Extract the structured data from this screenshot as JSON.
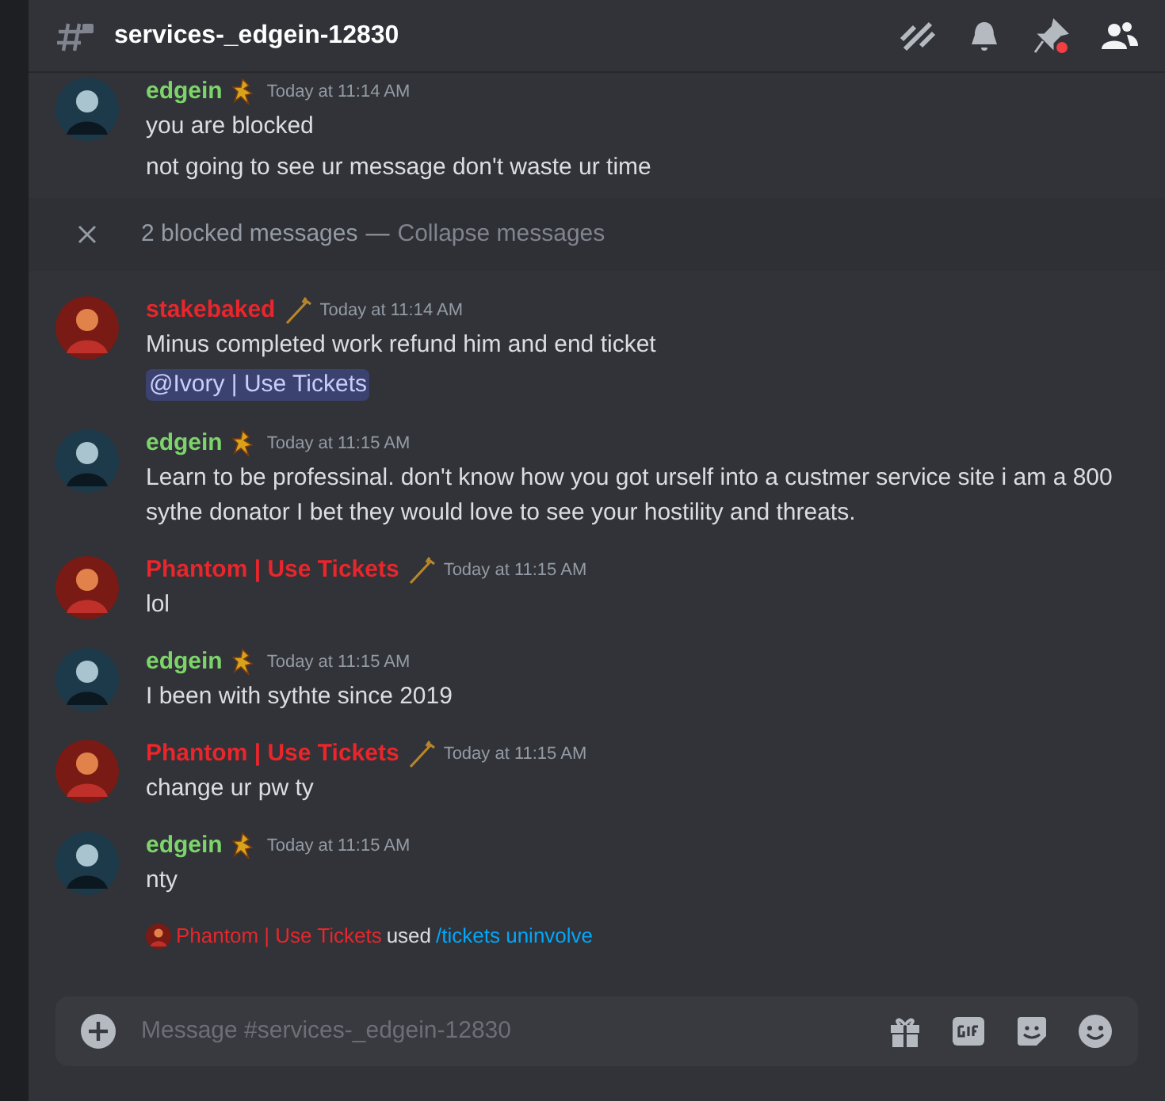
{
  "header": {
    "channel": "services-_edgein-12830"
  },
  "messages": [
    {
      "kind": "message",
      "author": "edgein",
      "color": "#7dd46a",
      "badge": {
        "kind": "figure"
      },
      "time": "Today at 11:14 AM",
      "lines": [
        "you are blocked",
        "not going to see ur message don't waste ur time"
      ]
    },
    {
      "kind": "blocked",
      "count_text": "2 blocked messages",
      "separator": "—",
      "action": "Collapse messages"
    },
    {
      "kind": "message",
      "author": "stakebaked",
      "color": "#e8262b",
      "badge": {
        "kind": "staff"
      },
      "time": "Today at 11:14 AM",
      "lines": [
        "Minus completed work refund him and end ticket"
      ],
      "mention": "@Ivory | Use Tickets"
    },
    {
      "kind": "message",
      "author": "edgein",
      "color": "#7dd46a",
      "badge": {
        "kind": "figure"
      },
      "time": "Today at 11:15 AM",
      "lines": [
        "Learn to be professinal. don't know how you got urself into a custmer service site i am a 800 sythe donator I bet they would love to see your hostility and threats."
      ]
    },
    {
      "kind": "message",
      "author": "Phantom | Use Tickets",
      "color": "#e8262b",
      "badge": {
        "kind": "staff"
      },
      "time": "Today at 11:15 AM",
      "lines": [
        "lol"
      ]
    },
    {
      "kind": "message",
      "author": "edgein",
      "color": "#7dd46a",
      "badge": {
        "kind": "figure"
      },
      "time": "Today at 11:15 AM",
      "lines": [
        "I been with sythte since 2019"
      ]
    },
    {
      "kind": "message",
      "author": "Phantom | Use Tickets",
      "color": "#e8262b",
      "badge": {
        "kind": "staff"
      },
      "time": "Today at 11:15 AM",
      "lines": [
        "change ur pw ty"
      ]
    },
    {
      "kind": "message",
      "author": "edgein",
      "color": "#7dd46a",
      "badge": {
        "kind": "figure"
      },
      "time": "Today at 11:15 AM",
      "lines": [
        "nty"
      ]
    },
    {
      "kind": "command",
      "author": "Phantom | Use Tickets",
      "color": "#e8262b",
      "verb": "used",
      "command": "/tickets uninvolve"
    }
  ],
  "composer": {
    "placeholder": "Message #services-_edgein-12830"
  }
}
